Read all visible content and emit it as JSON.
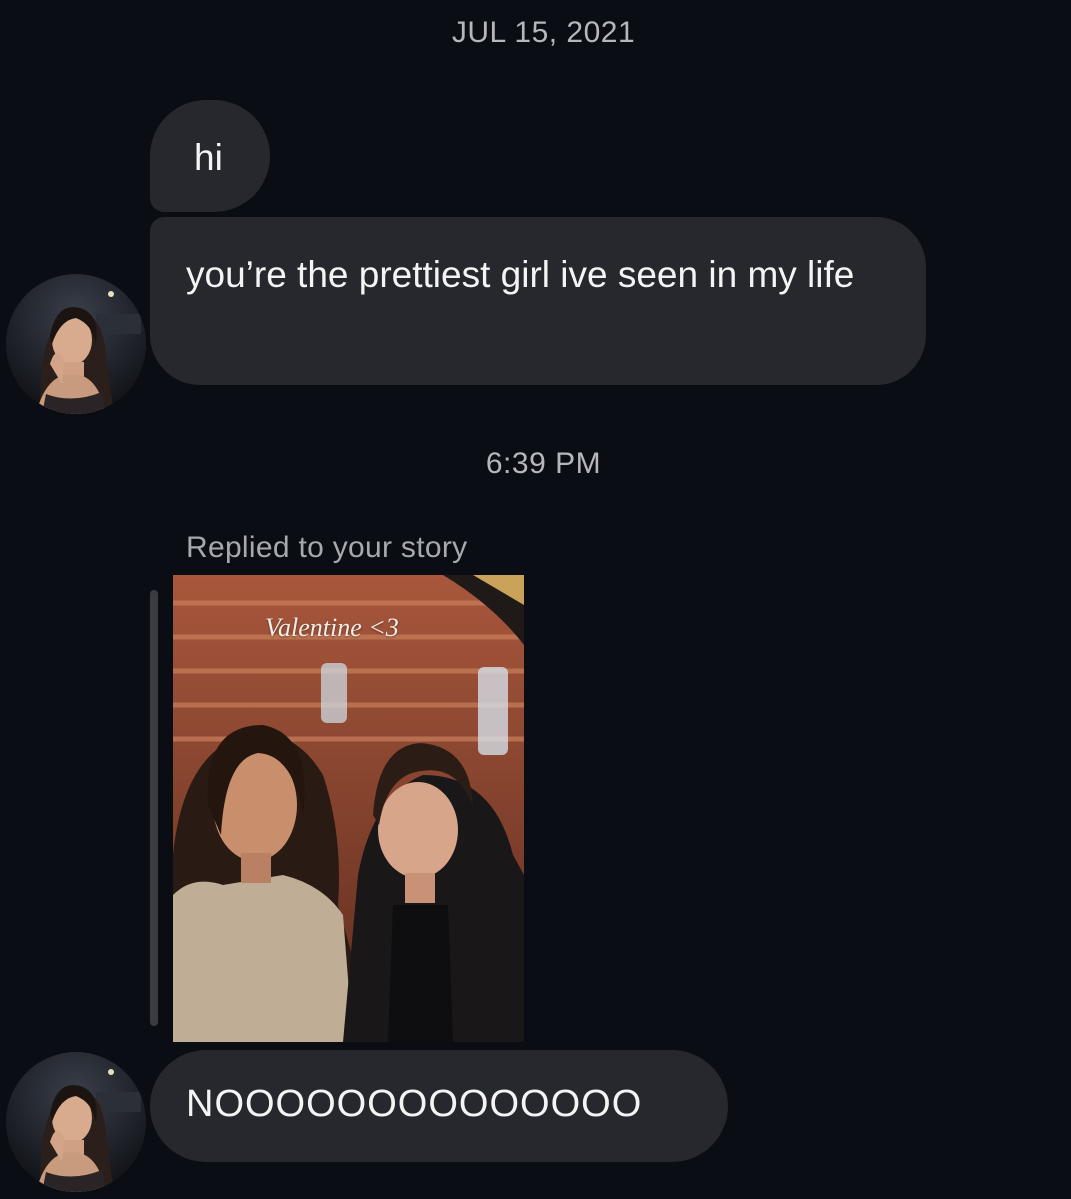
{
  "timestamps": {
    "date": "JUL 15, 2021",
    "time": "6:39 PM"
  },
  "messages": [
    {
      "text": "hi"
    },
    {
      "text": "you’re the prettiest girl ive seen in my life"
    },
    {
      "text": "NOOOOOOOOOOOOOO"
    }
  ],
  "story_reply": {
    "label": "Replied to your story",
    "caption": "Valentine <3"
  },
  "colors": {
    "background": "#0b0d14",
    "bubble": "#26282e",
    "muted_text": "#b5b7bd"
  }
}
